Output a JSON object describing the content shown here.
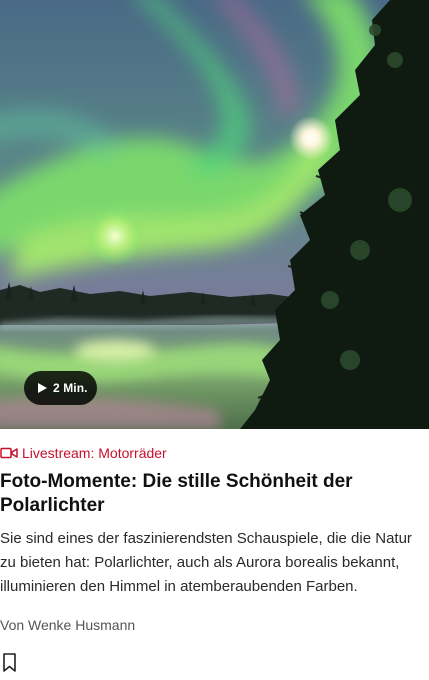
{
  "teaser_card": {
    "image": {
      "alt": "Polarlichter über einem See mit Nadelbäumen",
      "duration_label": "2 Min.",
      "play_icon": "play-icon"
    },
    "kicker": {
      "icon": "video-camera-icon",
      "text": "Livestream: Motorräder",
      "color": "#c8102e"
    },
    "headline": "Foto-Momente: Die stille Schönheit der Polarlichter",
    "teaser": "Sie sind eines der faszinierendsten Schauspiele, die die Natur zu bieten hat: Polarlichter, auch als Aurora borealis bekannt, illuminieren den Himmel in atemberaubenden Farben.",
    "byline": "Von Wenke Husmann",
    "bookmark_icon": "bookmark-icon"
  }
}
